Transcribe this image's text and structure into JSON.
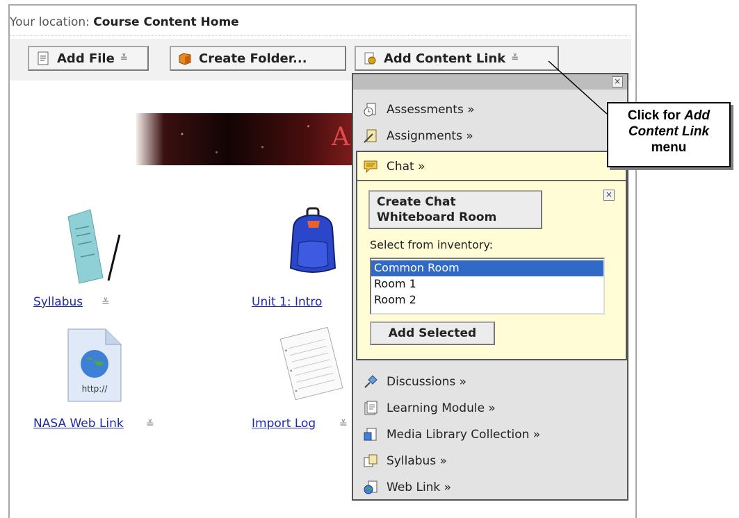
{
  "location": {
    "prefix": "Your location:",
    "value": "Course Content Home"
  },
  "toolbar": {
    "add_file": "Add File",
    "create_folder": "Create Folder...",
    "add_content_link": "Add Content Link"
  },
  "banner_letter": "A",
  "items": [
    {
      "label": "Syllabus",
      "icon": "syllabus-icon"
    },
    {
      "label": "Unit 1: Intro",
      "icon": "backpack-icon"
    },
    {
      "label": "NASA Web Link",
      "icon": "web-link-icon"
    },
    {
      "label": "Import Log",
      "icon": "notepad-icon"
    }
  ],
  "menu": {
    "close_glyph": "×",
    "items_top": [
      "Assessments »",
      "Assignments »"
    ],
    "chat": {
      "title": "Chat »",
      "create_button": [
        "Create Chat",
        "Whiteboard Room"
      ],
      "inventory_label": "Select from inventory:",
      "options": [
        "Common Room",
        "Room 1",
        "Room 2"
      ],
      "selected": "Common Room",
      "add_selected": "Add Selected"
    },
    "items_bottom": [
      "Discussions »",
      "Learning Module »",
      "Media Library Collection »",
      "Syllabus »",
      "Web Link »"
    ]
  },
  "callout": {
    "line1": "Click for ",
    "line1_em": "Add",
    "line2_em": "Content Link",
    "line3": "menu"
  },
  "colors": {
    "link": "#1e2aa8",
    "chat_panel": "#fffcd6",
    "selected_option": "#3169c6",
    "menu_bg": "#e3e3e3"
  }
}
